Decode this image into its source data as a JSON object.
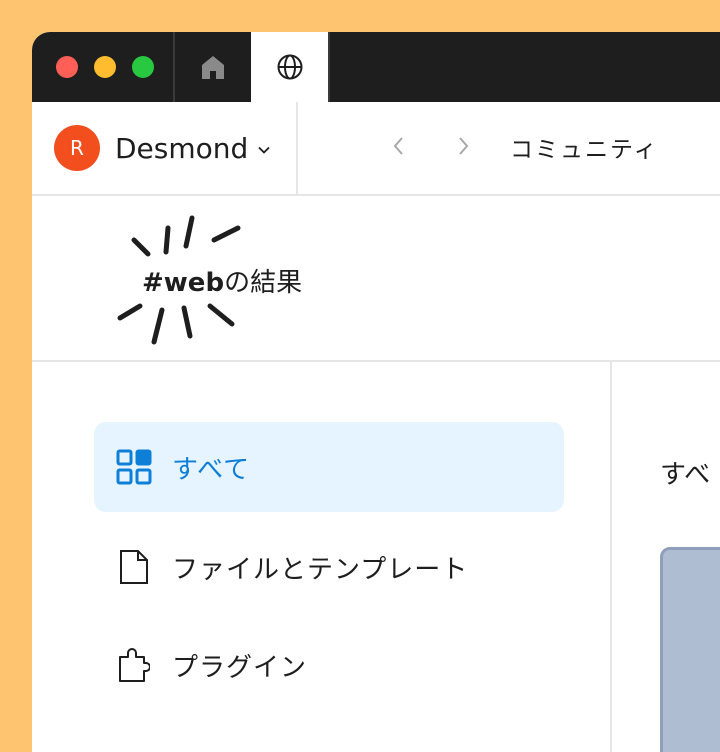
{
  "colors": {
    "background": "#FFC470",
    "titlebar": "#1e1e1e",
    "avatar": "#f24e1e",
    "active_bg": "#e5f4ff",
    "active_text": "#0d7fd6",
    "preview_card": "#aebdd2"
  },
  "titlebar": {
    "tabs": [
      {
        "icon": "home-icon"
      },
      {
        "icon": "globe-icon",
        "active": true
      }
    ]
  },
  "account": {
    "avatar_initial": "R",
    "name": "Desmond"
  },
  "nav": {
    "title": "コミュニティ"
  },
  "results": {
    "tag": "#web",
    "suffix": "の結果"
  },
  "sidebar": {
    "items": [
      {
        "label": "すべて",
        "icon": "grid-icon",
        "active": true
      },
      {
        "label": "ファイルとテンプレート",
        "icon": "file-icon",
        "active": false
      },
      {
        "label": "プラグイン",
        "icon": "plugin-icon",
        "active": false
      }
    ]
  },
  "main": {
    "heading": "すべ"
  }
}
